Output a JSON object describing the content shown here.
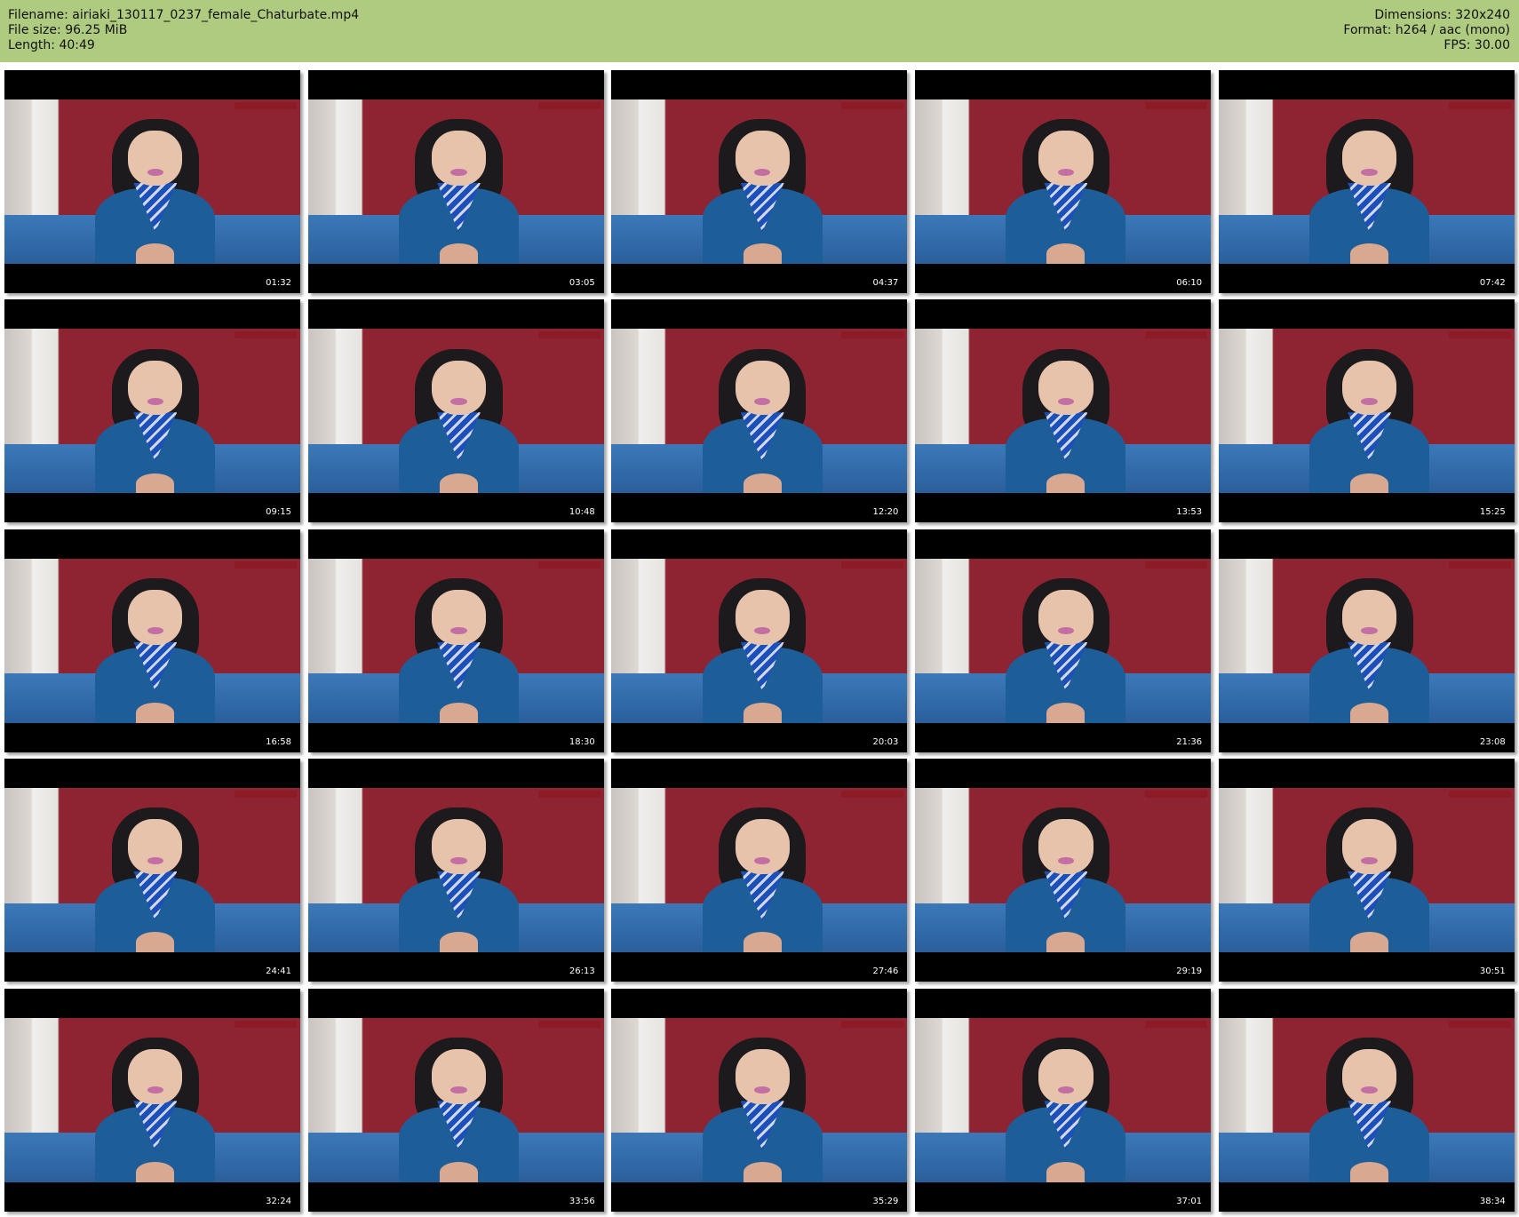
{
  "header": {
    "filename": "Filename: airiaki_130117_0237_female_Chaturbate.mp4",
    "file_size": "File size: 96.25 MiB",
    "length": "Length: 40:49",
    "dimensions": "Dimensions: 320x240",
    "format": "Format: h264 / aac (mono)",
    "fps": "FPS: 30.00"
  },
  "colors": {
    "header_bg": "#afcb80",
    "frame_border": "#000000",
    "timestamp_text": "#ffffff"
  },
  "thumbnails": [
    {
      "timestamp": "01:32"
    },
    {
      "timestamp": "03:05"
    },
    {
      "timestamp": "04:37"
    },
    {
      "timestamp": "06:10"
    },
    {
      "timestamp": "07:42"
    },
    {
      "timestamp": "09:15"
    },
    {
      "timestamp": "10:48"
    },
    {
      "timestamp": "12:20"
    },
    {
      "timestamp": "13:53"
    },
    {
      "timestamp": "15:25"
    },
    {
      "timestamp": "16:58"
    },
    {
      "timestamp": "18:30"
    },
    {
      "timestamp": "20:03"
    },
    {
      "timestamp": "21:36"
    },
    {
      "timestamp": "23:08"
    },
    {
      "timestamp": "24:41"
    },
    {
      "timestamp": "26:13"
    },
    {
      "timestamp": "27:46"
    },
    {
      "timestamp": "29:19"
    },
    {
      "timestamp": "30:51"
    },
    {
      "timestamp": "32:24"
    },
    {
      "timestamp": "33:56"
    },
    {
      "timestamp": "35:29"
    },
    {
      "timestamp": "37:01"
    },
    {
      "timestamp": "38:34"
    }
  ]
}
